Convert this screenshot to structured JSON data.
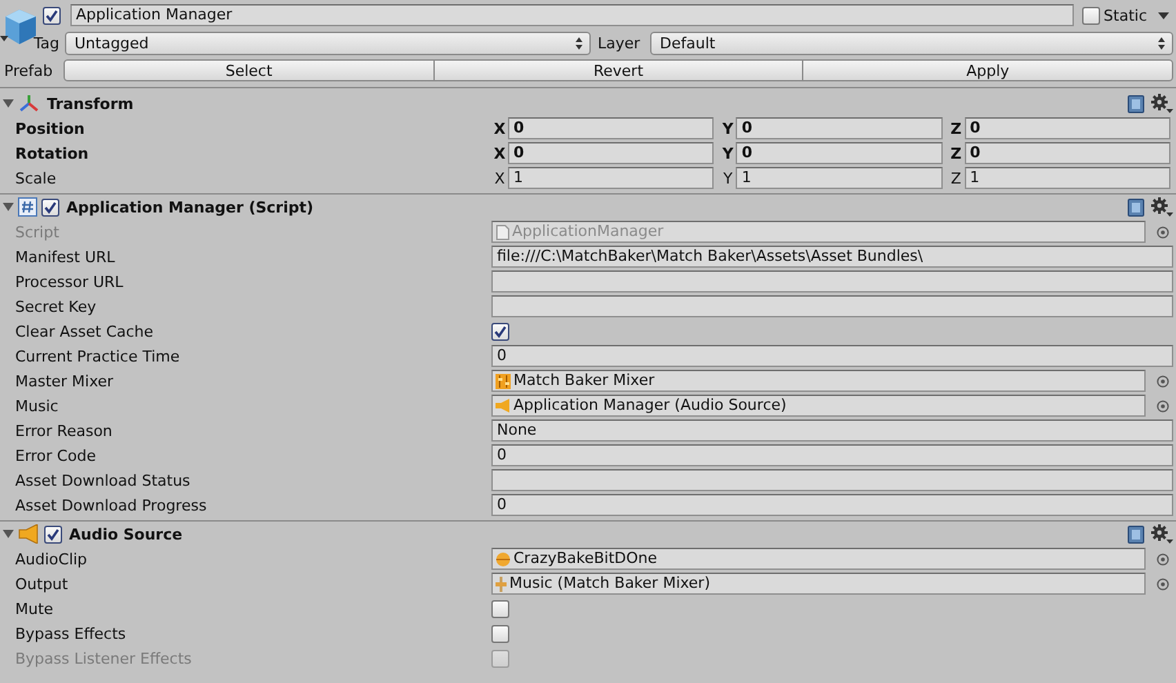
{
  "game_object": {
    "active": true,
    "name": "Application Manager",
    "static": false,
    "static_label": "Static",
    "tag_label": "Tag",
    "tag": "Untagged",
    "layer_label": "Layer",
    "layer": "Default",
    "prefab_label": "Prefab",
    "prefab_buttons": [
      "Select",
      "Revert",
      "Apply"
    ]
  },
  "components": [
    {
      "kind": "transform",
      "title": "Transform",
      "expanded": true,
      "rows": [
        {
          "label": "Position",
          "overridden": true,
          "axes": [
            {
              "axis": "X",
              "value": "0"
            },
            {
              "axis": "Y",
              "value": "0"
            },
            {
              "axis": "Z",
              "value": "0"
            }
          ]
        },
        {
          "label": "Rotation",
          "overridden": true,
          "axes": [
            {
              "axis": "X",
              "value": "0"
            },
            {
              "axis": "Y",
              "value": "0"
            },
            {
              "axis": "Z",
              "value": "0"
            }
          ]
        },
        {
          "label": "Scale",
          "overridden": false,
          "axes": [
            {
              "axis": "X",
              "value": "1"
            },
            {
              "axis": "Y",
              "value": "1"
            },
            {
              "axis": "Z",
              "value": "1"
            }
          ]
        }
      ]
    },
    {
      "kind": "script",
      "title": "Application Manager (Script)",
      "expanded": true,
      "enabled": true,
      "fields": [
        {
          "kind": "script_ref",
          "label": "Script",
          "disabled": true,
          "value": "ApplicationManager"
        },
        {
          "kind": "text",
          "label": "Manifest URL",
          "disabled": false,
          "value": "file:///C:\\MatchBaker\\Match Baker\\Assets\\Asset Bundles\\"
        },
        {
          "kind": "text",
          "label": "Processor URL",
          "disabled": false
        },
        {
          "kind": "text",
          "label": "Secret Key",
          "disabled": false
        },
        {
          "kind": "checkbox",
          "label": "Clear Asset Cache",
          "disabled": false,
          "checked": true
        },
        {
          "kind": "text",
          "label": "Current Practice Time",
          "disabled": false,
          "value": "0"
        },
        {
          "kind": "mixer_ref",
          "label": "Master Mixer",
          "disabled": false,
          "value": "Match Baker Mixer"
        },
        {
          "kind": "audio_source_ref",
          "label": "Music",
          "disabled": false,
          "value": "Application Manager (Audio Source)"
        },
        {
          "kind": "text",
          "label": "Error Reason",
          "disabled": false,
          "value": "None"
        },
        {
          "kind": "text",
          "label": "Error Code",
          "disabled": false,
          "value": "0"
        },
        {
          "kind": "text",
          "label": "Asset Download Status",
          "disabled": false
        },
        {
          "kind": "text",
          "label": "Asset Download Progress",
          "disabled": false,
          "value": "0"
        }
      ]
    },
    {
      "kind": "audio",
      "title": "Audio Source",
      "expanded": true,
      "enabled": true,
      "fields": [
        {
          "kind": "audio_clip_ref",
          "label": "AudioClip",
          "disabled": false,
          "value": "CrazyBakeBitDOne"
        },
        {
          "kind": "mixer_group_ref",
          "label": "Output",
          "disabled": false,
          "value": "Music (Match Baker Mixer)"
        },
        {
          "kind": "checkbox",
          "label": "Mute",
          "disabled": false,
          "checked": false
        },
        {
          "kind": "checkbox",
          "label": "Bypass Effects",
          "disabled": false,
          "checked": false
        },
        {
          "kind": "checkbox",
          "label": "Bypass Listener Effects",
          "disabled": true,
          "checked": false
        }
      ]
    }
  ]
}
